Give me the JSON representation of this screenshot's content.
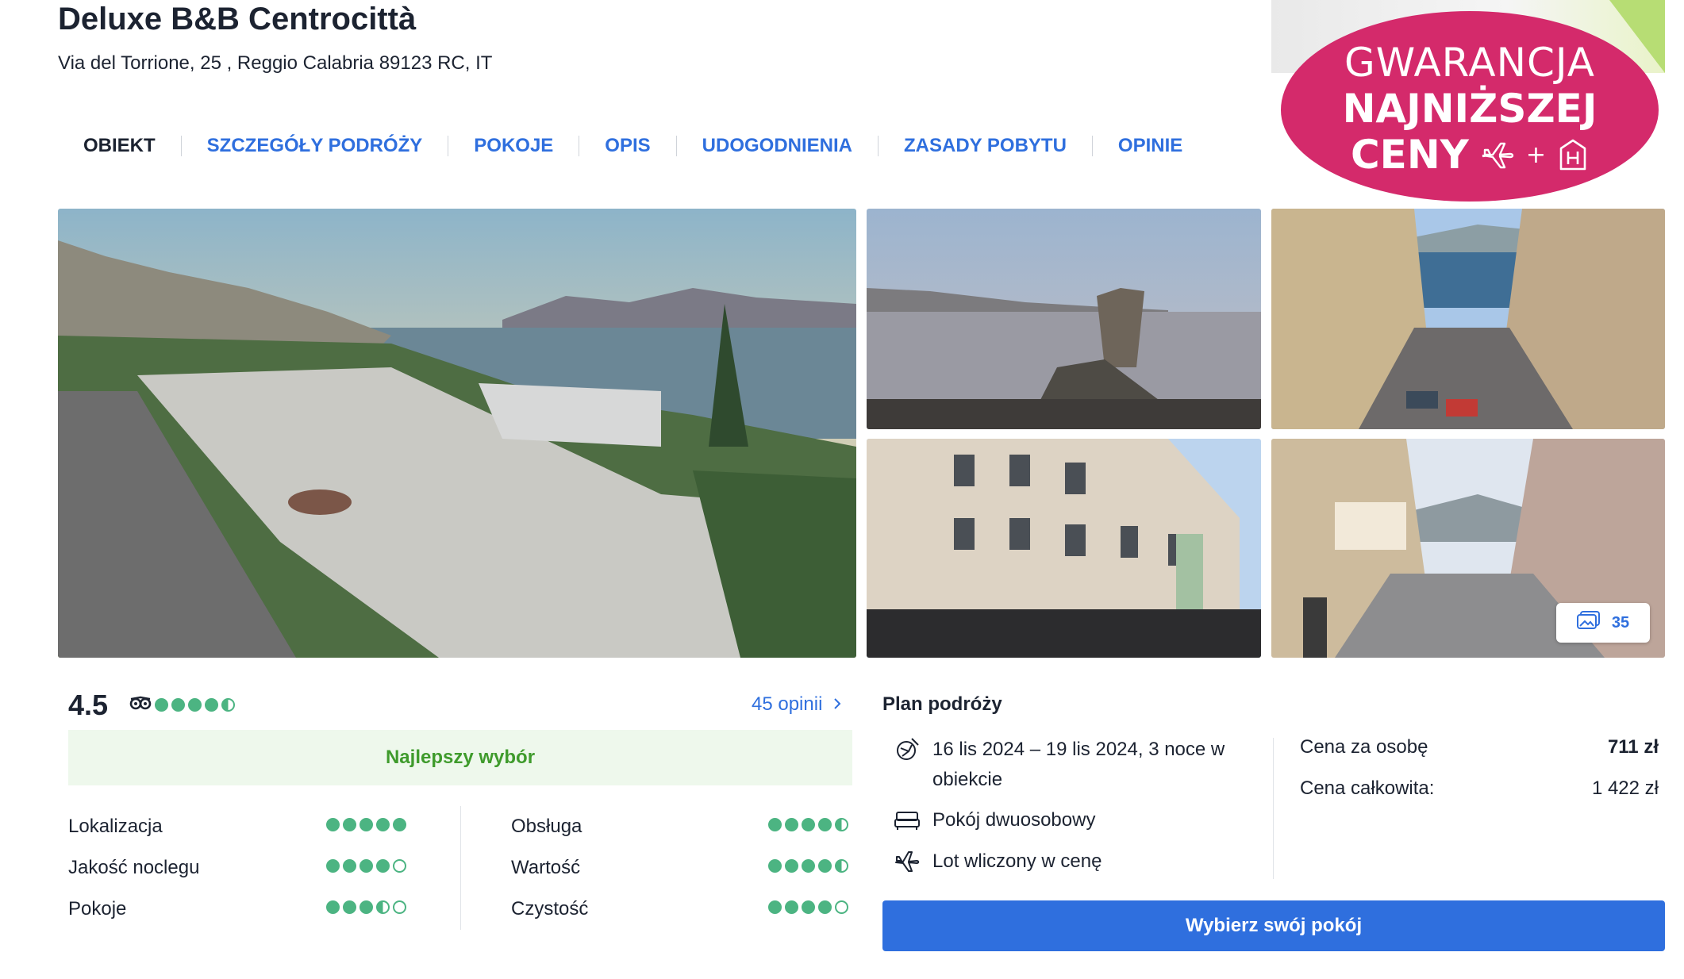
{
  "hotel": {
    "name": "Deluxe B&B Centrocittà",
    "address": "Via del Torrione, 25 , Reggio Calabria 89123 RC, IT"
  },
  "tabs": [
    {
      "label": "OBIEKT",
      "active": true
    },
    {
      "label": "SZCZEGÓŁY PODRÓŻY",
      "active": false
    },
    {
      "label": "POKOJE",
      "active": false
    },
    {
      "label": "OPIS",
      "active": false
    },
    {
      "label": "UDOGODNIENIA",
      "active": false
    },
    {
      "label": "ZASADY POBYTU",
      "active": false
    },
    {
      "label": "OPINIE",
      "active": false
    }
  ],
  "badge": {
    "line1": "GWARANCJA",
    "line2": "NAJNIŻSZEJ",
    "line3": "CENY",
    "icons": [
      "plane-icon",
      "plus-sign",
      "hotel-icon"
    ],
    "color": "#d42a6b"
  },
  "gallery": {
    "photo_count": "35",
    "photos": [
      "seafront-promenade-photo",
      "sea-monument-photo",
      "street-to-sea-photo",
      "museum-queue-photo",
      "shopping-street-photo"
    ]
  },
  "rating": {
    "score": "4.5",
    "stars": 4.5,
    "provider_icon": "tripadvisor-owl-icon",
    "reviews_label": "45 opinii",
    "best_choice": "Najlepszy wybór",
    "categories_left": [
      {
        "label": "Lokalizacja",
        "value": 5
      },
      {
        "label": "Jakość noclegu",
        "value": 4
      },
      {
        "label": "Pokoje",
        "value": 3.5
      }
    ],
    "categories_right": [
      {
        "label": "Obsługa",
        "value": 4.5
      },
      {
        "label": "Wartość",
        "value": 4.5
      },
      {
        "label": "Czystość",
        "value": 4
      }
    ],
    "color": "#4cb482"
  },
  "plan": {
    "title": "Plan podróży",
    "dates_line1": "16 lis 2024 – 19 lis 2024, 3 noce w",
    "dates_line2": "obiekcie",
    "room": "Pokój dwuosobowy",
    "flight": "Lot wliczony w cenę",
    "price_per_person_label": "Cena za osobę",
    "price_per_person": "711 zł",
    "total_label": "Cena całkowita:",
    "total": "1 422 zł",
    "cta": "Wybierz swój pokój",
    "accent": "#2f6fde"
  }
}
